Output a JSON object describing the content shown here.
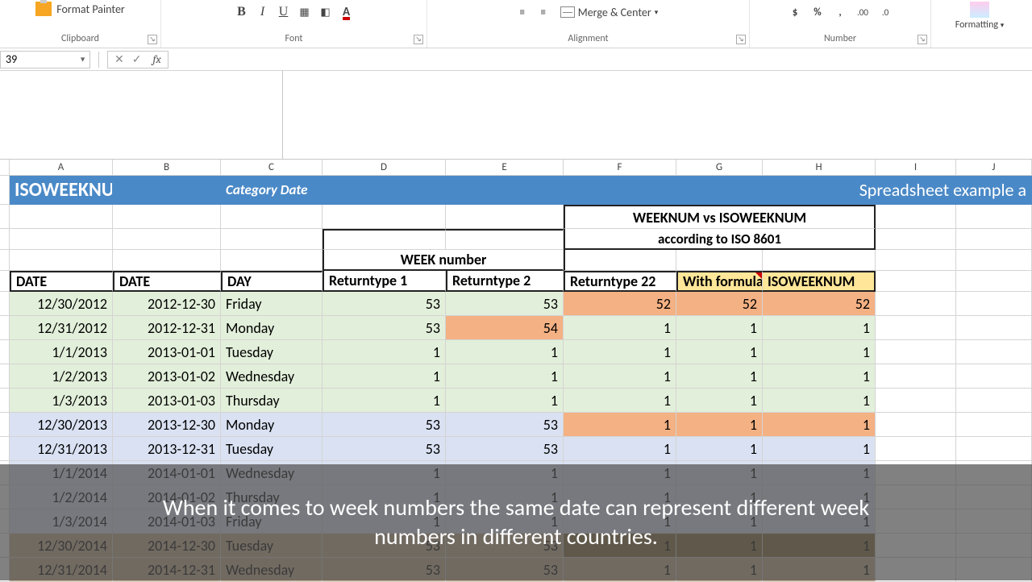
{
  "ribbon": {
    "clipboard": {
      "label": "Clipboard",
      "format_painter": "Format Painter"
    },
    "font": {
      "label": "Font"
    },
    "alignment": {
      "label": "Alignment",
      "merge": "Merge & Center"
    },
    "number": {
      "label": "Number",
      "d1": ".00",
      "d2": ".0"
    },
    "formatting": {
      "label": "Formatting",
      "dd": "▾"
    }
  },
  "namebox": {
    "value": "39"
  },
  "fx": {
    "cancel": "✕",
    "enter": "✓",
    "fx": "fx"
  },
  "cols": [
    "A",
    "B",
    "C",
    "D",
    "E",
    "F",
    "G",
    "H",
    "I",
    "J"
  ],
  "title": {
    "func": "ISOWEEKNUM",
    "cat": "Category Date",
    "right": "Spreadsheet example a"
  },
  "hdr2": {
    "weeknum_vs": "WEEKNUM vs  ISOWEEKNUM",
    "according": "according to ISO 8601"
  },
  "hdr3": {
    "weeknumber": "WEEK number"
  },
  "hdr4": {
    "date1": "DATE",
    "date2": "DATE",
    "day": "DAY",
    "rt1": "Returntype 1",
    "rt2": "Returntype 2",
    "rt22": "Returntype 22",
    "withf": "With formula",
    "isow": "ISOWEEKNUM"
  },
  "rowsData": [
    {
      "a": "12/30/2012",
      "b": "2012-12-30",
      "c": "Friday",
      "d": "53",
      "e": "53",
      "f": "52",
      "g": "52",
      "h": "52",
      "bg": "green",
      "hl": "fgh"
    },
    {
      "a": "12/31/2012",
      "b": "2012-12-31",
      "c": "Monday",
      "d": "53",
      "e": "54",
      "f": "1",
      "g": "1",
      "h": "1",
      "bg": "green",
      "hl": "e"
    },
    {
      "a": "1/1/2013",
      "b": "2013-01-01",
      "c": "Tuesday",
      "d": "1",
      "e": "1",
      "f": "1",
      "g": "1",
      "h": "1",
      "bg": "green"
    },
    {
      "a": "1/2/2013",
      "b": "2013-01-02",
      "c": "Wednesday",
      "d": "1",
      "e": "1",
      "f": "1",
      "g": "1",
      "h": "1",
      "bg": "green"
    },
    {
      "a": "1/3/2013",
      "b": "2013-01-03",
      "c": "Thursday",
      "d": "1",
      "e": "1",
      "f": "1",
      "g": "1",
      "h": "1",
      "bg": "green"
    },
    {
      "a": "12/30/2013",
      "b": "2013-12-30",
      "c": "Monday",
      "d": "53",
      "e": "53",
      "f": "1",
      "g": "1",
      "h": "1",
      "bg": "blue",
      "hl": "fgh"
    },
    {
      "a": "12/31/2013",
      "b": "2013-12-31",
      "c": "Tuesday",
      "d": "53",
      "e": "53",
      "f": "1",
      "g": "1",
      "h": "1",
      "bg": "blue"
    },
    {
      "a": "1/1/2014",
      "b": "2014-01-01",
      "c": "Wednesday",
      "d": "1",
      "e": "1",
      "f": "1",
      "g": "1",
      "h": "1",
      "bg": "blue"
    },
    {
      "a": "1/2/2014",
      "b": "2014-01-02",
      "c": "Thursday",
      "d": "1",
      "e": "1",
      "f": "1",
      "g": "1",
      "h": "1",
      "bg": "blue"
    },
    {
      "a": "1/3/2014",
      "b": "2014-01-03",
      "c": "Friday",
      "d": "1",
      "e": "1",
      "f": "1",
      "g": "1",
      "h": "1",
      "bg": "blue"
    },
    {
      "a": "12/30/2014",
      "b": "2014-12-30",
      "c": "Tuesday",
      "d": "53",
      "e": "53",
      "f": "1",
      "g": "1",
      "h": "1",
      "bg": "tan",
      "hl": "fghdark"
    },
    {
      "a": "12/31/2014",
      "b": "2014-12-31",
      "c": "Wednesday",
      "d": "53",
      "e": "53",
      "f": "1",
      "g": "1",
      "h": "1",
      "bg": "tan"
    }
  ],
  "caption": "When it comes to week numbers the same date can represent different week numbers in different countries."
}
